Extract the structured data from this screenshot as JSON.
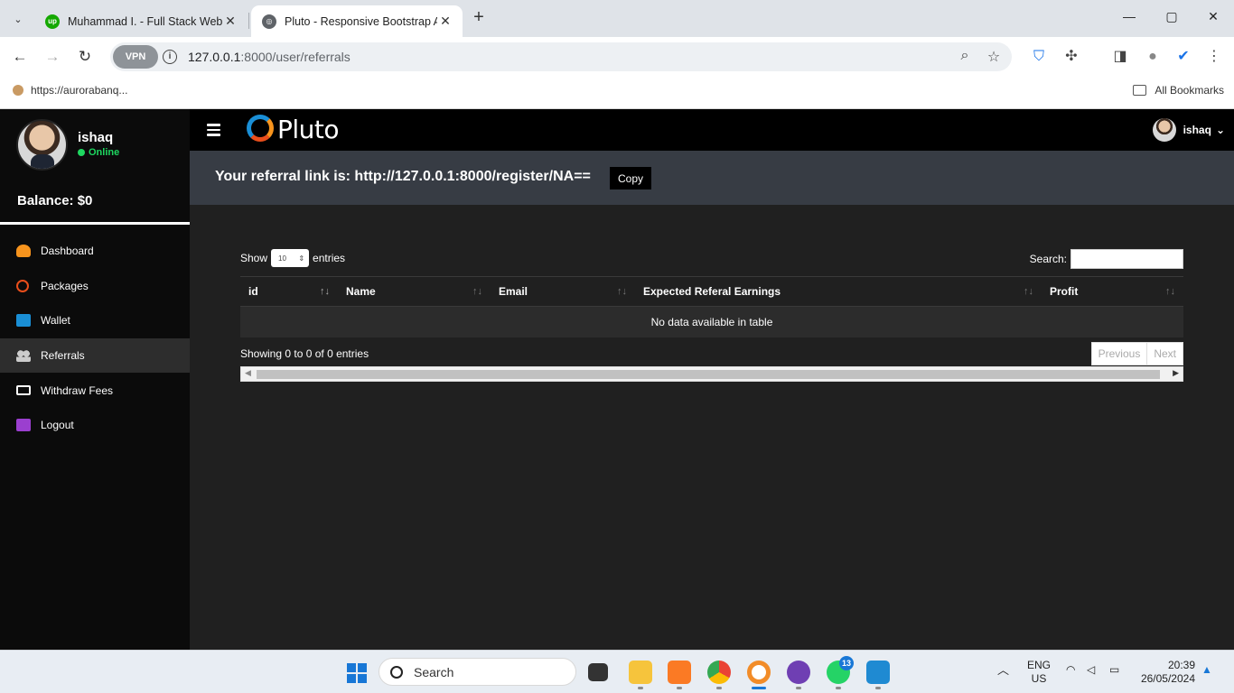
{
  "browser": {
    "tabs": [
      {
        "title": "Muhammad I. - Full Stack Web D",
        "favicon": "upwork-icon",
        "active": false
      },
      {
        "title": "Pluto - Responsive Bootstrap Ad",
        "favicon": "globe-icon",
        "active": true
      }
    ],
    "new_tab": "+",
    "window_controls": {
      "minimize": "—",
      "maximize": "▢",
      "close": "✕"
    },
    "nav": {
      "back": "←",
      "forward": "→",
      "reload": "↻"
    },
    "vpn_label": "VPN",
    "url_host": "127.0.0.1",
    "url_rest": ":8000/user/referrals",
    "bookmark": "https://aurorabanq...",
    "all_bookmarks": "All Bookmarks"
  },
  "sidebar": {
    "user_name": "ishaq",
    "status": "Online",
    "balance": "Balance: $0",
    "items": [
      {
        "label": "Dashboard",
        "icon": "dashboard-icon",
        "color": "#f7941d"
      },
      {
        "label": "Packages",
        "icon": "clock-icon",
        "color": "#e94e1b"
      },
      {
        "label": "Wallet",
        "icon": "briefcase-icon",
        "color": "#1a8fd6"
      },
      {
        "label": "Referrals",
        "icon": "users-icon",
        "color": "#cccccc"
      },
      {
        "label": "Withdraw Fees",
        "icon": "money-icon",
        "color": "#ffffff"
      },
      {
        "label": "Logout",
        "icon": "map-icon",
        "color": "#9b3fcf"
      }
    ]
  },
  "topbar": {
    "logo_text": "Pluto",
    "user_name": "ishaq",
    "dropdown": "⌄"
  },
  "referral": {
    "label": "Your referral link is: ",
    "link": "http://127.0.0.1:8000/register/NA==",
    "copy": "Copy"
  },
  "table": {
    "show": "Show",
    "length_value": "10",
    "entries": "entries",
    "search_label": "Search:",
    "columns": [
      "id",
      "Name",
      "Email",
      "Expected Referal Earnings",
      "Profit"
    ],
    "empty_message": "No data available in table",
    "info": "Showing 0 to 0 of 0 entries",
    "previous": "Previous",
    "next": "Next"
  },
  "taskbar": {
    "search_placeholder": "Search",
    "whatsapp_badge": "13",
    "language": "ENG",
    "region": "US",
    "time": "20:39",
    "date": "26/05/2024"
  },
  "colors": {
    "sidebar_bg": "#0b0b0b",
    "referral_bar_bg": "#373c44",
    "content_bg": "#202020",
    "online_green": "#1ed760"
  }
}
